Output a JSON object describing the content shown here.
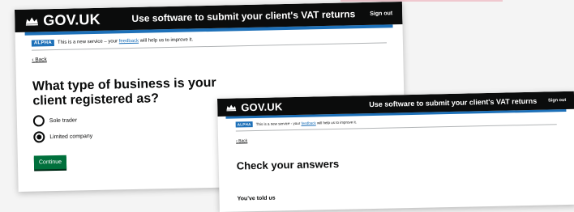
{
  "colors": {
    "header_bg": "#0b0c0c",
    "blue_bar": "#1d70b8",
    "button_green": "#00703c",
    "tag_blue": "#1d70b8"
  },
  "screen1": {
    "header": {
      "logo": "GOV.UK",
      "service": "Use software to submit your client's VAT returns",
      "signout": "Sign out"
    },
    "phase": {
      "tag": "ALPHA",
      "text_before": "This is a new service – your",
      "link": "feedback",
      "text_after": "will help us to improve it."
    },
    "back": "Back",
    "question": "What type of business is your client registered as?",
    "options": [
      {
        "label": "Sole trader",
        "checked": false
      },
      {
        "label": "Limited company",
        "checked": true
      }
    ],
    "button": "Continue"
  },
  "screen2": {
    "header": {
      "logo": "GOV.UK",
      "service": "Use software to submit your client's VAT returns",
      "signout": "Sign out"
    },
    "phase": {
      "tag": "ALPHA",
      "text_before": "This is a new service - your",
      "link": "feedback",
      "text_after": "will help us to improve it."
    },
    "back": "Back",
    "heading": "Check your answers",
    "subheading": "You've told us"
  }
}
